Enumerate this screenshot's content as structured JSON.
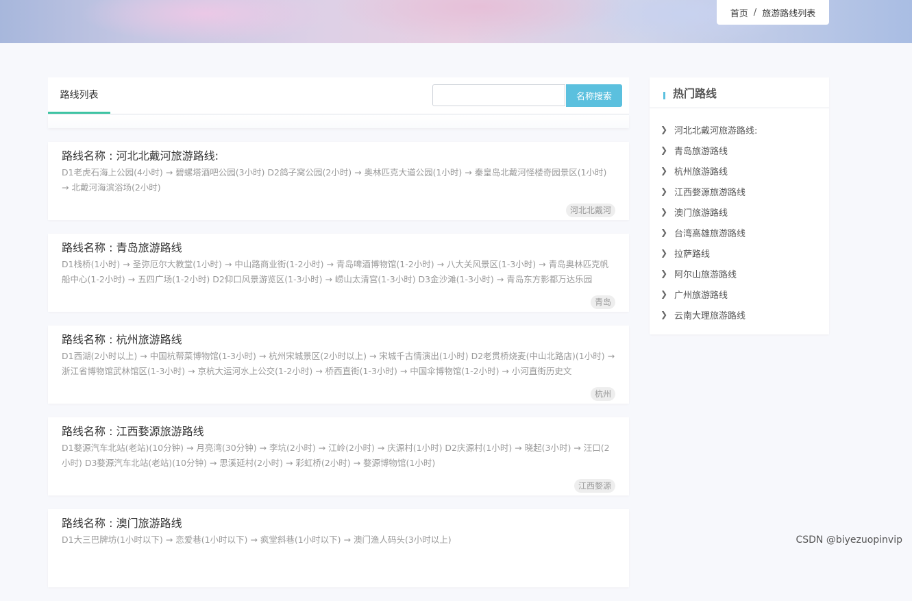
{
  "breadcrumb": {
    "home": "首页",
    "separator": "/",
    "current": "旅游路线列表"
  },
  "main": {
    "tab_label": "路线列表",
    "search": {
      "value": "",
      "placeholder": "",
      "button_label": "名称搜索"
    },
    "routes": [
      {
        "title": "路线名称 : 河北北戴河旅游路线:",
        "description": "D1老虎石海上公园(4小时) → 碧螺塔酒吧公园(3小时) D2鸽子窝公园(2小时) → 奥林匹克大道公园(1小时) → 秦皇岛北戴河怪楼奇园景区(1小时) → 北戴河海滨浴场(2小时)",
        "tag": "河北北戴河"
      },
      {
        "title": "路线名称 : 青岛旅游路线",
        "description": "D1栈桥(1小时) → 圣弥厄尔大教堂(1小时) → 中山路商业街(1-2小时) → 青岛啤酒博物馆(1-2小时) → 八大关风景区(1-3小时) → 青岛奥林匹克帆船中心(1-2小时) → 五四广场(1-2小时) D2仰口风景游览区(1-3小时) → 崂山太清宫(1-3小时) D3金沙滩(1-3小时) → 青岛东方影都万达乐园",
        "tag": "青岛"
      },
      {
        "title": "路线名称 : 杭州旅游路线",
        "description": "D1西湖(2小时以上) → 中国杭帮菜博物馆(1-3小时) → 杭州宋城景区(2小时以上) → 宋城千古情演出(1小时) D2老贯桥烧麦(中山北路店)(1小时) → 浙江省博物馆武林馆区(1-3小时) → 京杭大运河水上公交(1-2小时) → 桥西直街(1-3小时) → 中国伞博物馆(1-2小时) → 小河直街历史文",
        "tag": "杭州"
      },
      {
        "title": "路线名称 : 江西婺源旅游路线",
        "description": "D1婺源汽车北站(老站)(10分钟) → 月亮湾(30分钟) → 李坑(2小时) → 江岭(2小时) → 庆源村(1小时) D2庆源村(1小时) → 晓起(3小时) → 汪口(2小时) D3婺源汽车北站(老站)(10分钟) → 思溪延村(2小时) → 彩虹桥(2小时) → 婺源博物馆(1小时)",
        "tag": "江西婺源"
      },
      {
        "title": "路线名称 : 澳门旅游路线",
        "description": "D1大三巴牌坊(1小时以下) → 恋爱巷(1小时以下) → 疯堂斜巷(1小时以下) → 澳门渔人码头(3小时以上)",
        "tag": ""
      }
    ]
  },
  "sidebar": {
    "title": "热门路线",
    "items": [
      "河北北戴河旅游路线:",
      "青岛旅游路线",
      "杭州旅游路线",
      "江西婺源旅游路线",
      "澳门旅游路线",
      "台湾高雄旅游路线",
      "拉萨路线",
      "阿尔山旅游路线",
      "广州旅游路线",
      "云南大理旅游路线"
    ]
  },
  "watermark": "CSDN @biyezuopinvip",
  "colors": {
    "accent_tab": "#3ec4a3",
    "search_button": "#5bc0de",
    "page_bg": "#f7f8fc"
  },
  "icons": {
    "list_item": "chevron-right-icon"
  }
}
